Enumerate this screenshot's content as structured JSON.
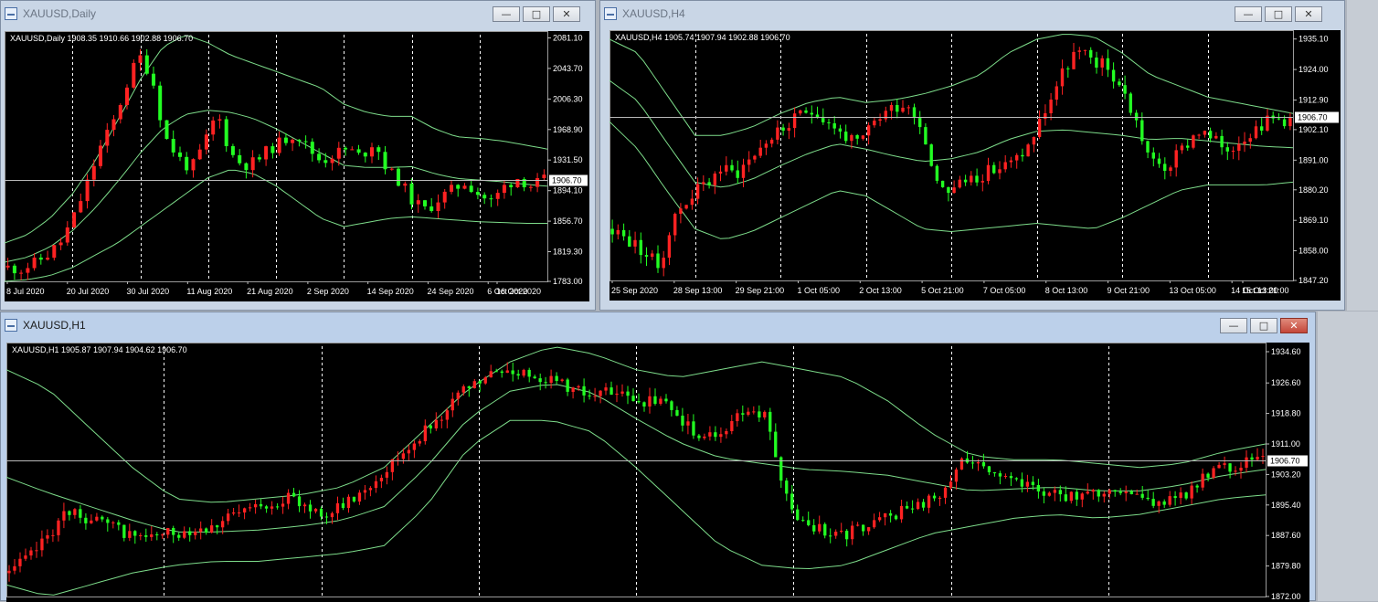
{
  "windows": [
    {
      "id": "daily",
      "title": "XAUUSD,Daily",
      "header": "XAUUSD,Daily  1908.35 1910.66 1902.88 1906.70",
      "current_price": "1906.70",
      "y_labels": [
        "2081.10",
        "2043.70",
        "2006.30",
        "1968.90",
        "1931.50",
        "1894.10",
        "1856.70",
        "1819.30",
        "1783.00"
      ],
      "y_range": [
        1783.0,
        2085.0
      ],
      "x_labels": [
        "8 Jul 2020",
        "20 Jul 2020",
        "30 Jul 2020",
        "11 Aug 2020",
        "21 Aug 2020",
        "2 Sep 2020",
        "14 Sep 2020",
        "24 Sep 2020",
        "6 Oct 2020",
        "16 Oct 2020"
      ],
      "colors": {
        "up": "#ff2222",
        "down": "#22ff22",
        "bands": "#7ddc8a"
      }
    },
    {
      "id": "h4",
      "title": "XAUUSD,H4",
      "header": "XAUUSD,H4  1905.74 1907.94 1902.88 1906.70",
      "current_price": "1906.70",
      "y_labels": [
        "1935.10",
        "1924.00",
        "1912.90",
        "1902.10",
        "1891.00",
        "1880.20",
        "1869.10",
        "1858.00",
        "1847.20"
      ],
      "y_range": [
        1847.2,
        1937.0
      ],
      "x_labels": [
        "25 Sep 2020",
        "28 Sep 13:00",
        "29 Sep 21:00",
        "1 Oct 05:00",
        "2 Oct 13:00",
        "5 Oct 21:00",
        "7 Oct 05:00",
        "8 Oct 13:00",
        "9 Oct 21:00",
        "13 Oct 05:00",
        "14 Oct 13:00",
        "15 Oct 21:00"
      ],
      "colors": {
        "up": "#ff2222",
        "down": "#22ff22",
        "bands": "#7ddc8a"
      }
    },
    {
      "id": "h1",
      "title": "XAUUSD,H1",
      "header": "XAUUSD,H1  1905.87 1907.94 1904.62 1906.70",
      "current_price": "1906.70",
      "y_labels": [
        "1934.60",
        "1926.60",
        "1918.80",
        "1911.00",
        "1903.20",
        "1895.40",
        "1887.60",
        "1879.80",
        "1872.00"
      ],
      "y_range": [
        1872.0,
        1936.0
      ],
      "x_labels": [],
      "colors": {
        "up": "#ff2222",
        "down": "#22ff22",
        "bands": "#7ddc8a"
      }
    }
  ],
  "controls": {
    "minimize": "—",
    "maximize": "□",
    "close": "✕"
  },
  "chart_data": [
    {
      "type": "candlestick",
      "title": "XAUUSD,Daily",
      "ylim": [
        1783.0,
        2085.0
      ],
      "x": [
        "8 Jul 2020",
        "20 Jul 2020",
        "30 Jul 2020",
        "11 Aug 2020",
        "21 Aug 2020",
        "2 Sep 2020",
        "14 Sep 2020",
        "24 Sep 2020",
        "6 Oct 2020",
        "16 Oct 2020"
      ],
      "close_path": [
        1800,
        1798,
        1805,
        1815,
        1830,
        1860,
        1900,
        1945,
        1975,
        2020,
        2060,
        2035,
        1960,
        1935,
        1920,
        1950,
        1990,
        1940,
        1925,
        1930,
        1945,
        1955,
        1965,
        1945,
        1930,
        1940,
        1945,
        1935,
        1955,
        1920,
        1905,
        1880,
        1870,
        1885,
        1895,
        1905,
        1890,
        1880,
        1900,
        1910,
        1900,
        1907
      ],
      "bands_upper": [
        1830,
        1840,
        1860,
        1890,
        1930,
        1980,
        2030,
        2070,
        2085,
        2075,
        2060,
        2050,
        2040,
        2030,
        2020,
        2000,
        1990,
        1985,
        1985,
        1970,
        1960,
        1958,
        1955,
        1950,
        1945
      ],
      "bands_lower": [
        1783,
        1785,
        1790,
        1800,
        1815,
        1830,
        1850,
        1870,
        1890,
        1910,
        1920,
        1915,
        1900,
        1880,
        1860,
        1850,
        1855,
        1860,
        1862,
        1860,
        1858,
        1856,
        1855,
        1854,
        1854
      ]
    },
    {
      "type": "candlestick",
      "title": "XAUUSD,H4",
      "ylim": [
        1847.2,
        1937.0
      ],
      "x": [
        "25 Sep 2020",
        "28 Sep 13:00",
        "29 Sep 21:00",
        "1 Oct 05:00",
        "2 Oct 13:00",
        "5 Oct 21:00",
        "7 Oct 05:00",
        "8 Oct 13:00",
        "9 Oct 21:00",
        "13 Oct 05:00",
        "14 Oct 13:00",
        "15 Oct 21:00"
      ],
      "close_path": [
        1866,
        1862,
        1858,
        1852,
        1870,
        1878,
        1882,
        1888,
        1886,
        1892,
        1898,
        1902,
        1906,
        1910,
        1905,
        1900,
        1896,
        1905,
        1910,
        1912,
        1905,
        1884,
        1880,
        1884,
        1886,
        1888,
        1890,
        1896,
        1908,
        1920,
        1930,
        1928,
        1925,
        1918,
        1905,
        1890,
        1888,
        1895,
        1902,
        1898,
        1895,
        1900,
        1904,
        1906,
        1906
      ],
      "bands_upper": [
        1935,
        1930,
        1915,
        1900,
        1900,
        1903,
        1908,
        1912,
        1914,
        1912,
        1913,
        1915,
        1918,
        1922,
        1930,
        1935,
        1937,
        1936,
        1930,
        1922,
        1918,
        1914,
        1912,
        1910,
        1908
      ],
      "bands_lower": [
        1905,
        1895,
        1880,
        1866,
        1862,
        1865,
        1870,
        1875,
        1880,
        1878,
        1872,
        1866,
        1865,
        1866,
        1867,
        1868,
        1867,
        1866,
        1870,
        1875,
        1880,
        1882,
        1882,
        1882,
        1883
      ]
    },
    {
      "type": "candlestick",
      "title": "XAUUSD,H1",
      "ylim": [
        1872.0,
        1936.0
      ],
      "x": [],
      "close_path": [
        1878,
        1882,
        1888,
        1894,
        1892,
        1890,
        1888,
        1887,
        1888,
        1889,
        1890,
        1892,
        1894,
        1896,
        1897,
        1895,
        1893,
        1896,
        1900,
        1905,
        1910,
        1915,
        1920,
        1925,
        1928,
        1930,
        1929,
        1928,
        1926,
        1924,
        1924,
        1923,
        1922,
        1921,
        1916,
        1912,
        1915,
        1920,
        1918,
        1898,
        1890,
        1889,
        1888,
        1890,
        1892,
        1894,
        1896,
        1898,
        1908,
        1906,
        1902,
        1900,
        1899,
        1898,
        1897,
        1899,
        1900,
        1897,
        1896,
        1898,
        1902,
        1905,
        1906,
        1907
      ],
      "bands_upper": [
        1930,
        1925,
        1915,
        1905,
        1897,
        1896,
        1897,
        1898,
        1900,
        1905,
        1915,
        1925,
        1932,
        1936,
        1934,
        1930,
        1928,
        1930,
        1932,
        1930,
        1928,
        1922,
        1914,
        1908,
        1907,
        1907,
        1906,
        1905,
        1906,
        1909,
        1911
      ],
      "bands_lower": [
        1875,
        1872,
        1875,
        1878,
        1880,
        1881,
        1881,
        1882,
        1883,
        1885,
        1895,
        1910,
        1917,
        1917,
        1914,
        1905,
        1895,
        1885,
        1880,
        1879,
        1880,
        1884,
        1888,
        1890,
        1892,
        1893,
        1892,
        1893,
        1895,
        1897,
        1898
      ]
    }
  ]
}
